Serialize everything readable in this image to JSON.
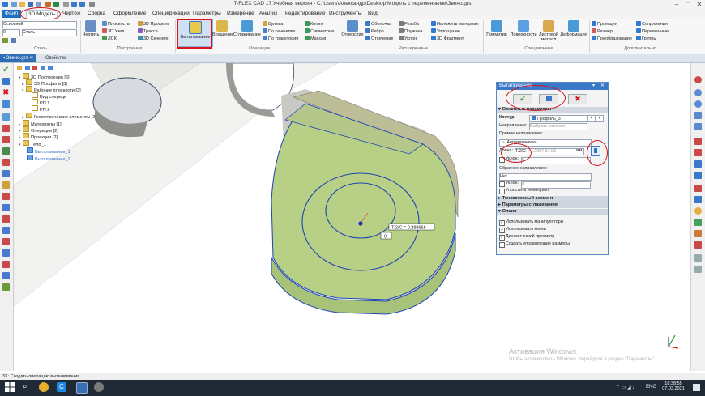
{
  "app": {
    "title": "T-FLEX CAD 17 Учебная версия - C:\\Users\\Александр\\Desktop\\Модель с переменными\\Звено.grs"
  },
  "menu": [
    "Файл",
    "3D Модель",
    "Чертёж",
    "Сборка",
    "Оформление",
    "Спецификации",
    "Параметры",
    "Измерение",
    "Анализ",
    "Редактирование",
    "Инструменты",
    "Вид"
  ],
  "ribbon": {
    "style": {
      "layer": "Основной",
      "value": "0",
      "line_style": "Сталь",
      "group": "Стиль"
    },
    "construct": {
      "draw": "Чертить",
      "items": [
        "Плоскость",
        "3D Узел",
        "ЛСК",
        "3D Профиль",
        "Трасса",
        "3D Сечение"
      ],
      "group": "Построения"
    },
    "operations": {
      "extrude": "Выталкивание",
      "rotate": "Вращение",
      "smooth": "Сглаживание",
      "items": [
        "Булева",
        "По сечениям",
        "По траектории",
        "Копия",
        "Симметрия",
        "Массив"
      ],
      "group": "Операции"
    },
    "extended": {
      "hole": "Отверстие",
      "items": [
        "Оболочка",
        "Ребро",
        "Отсечение",
        "Резьба",
        "Пружина",
        "Уклон",
        "Наложить материал",
        "Упрощение",
        "3D Фрагмент"
      ],
      "group": "Расширенные"
    },
    "special": {
      "primitives": "Примитив",
      "surfaces": "Поверхности",
      "sheet": "Листовой металл",
      "deform": "Деформация",
      "group": "Специальные"
    },
    "extra": {
      "items": [
        "Проекция",
        "Размер",
        "Преобразование",
        "Сопряжения",
        "Переменные",
        "Группы"
      ],
      "group": "Дополнительно"
    }
  },
  "tabs": {
    "doc": "Звено.grs",
    "props": "Свойства"
  },
  "tree": [
    "3D Построения [6]",
    "3D Профили [3]",
    "Рабочие плоскости [3]",
    "Вид спереди",
    "РП 1",
    "РП 2",
    "Геометрические элементы [2]",
    "Материалы [1]",
    "Операции [2]",
    "Проекции [2]",
    "Тело_1",
    "Выталкивание_1",
    "Выталкивание_2"
  ],
  "dialog": {
    "title": "Выталкивание",
    "sections": {
      "main": "Основные параметры",
      "thin": "Тонкостенный элемент",
      "smooth": "Параметры сглаживания",
      "options": "Опции"
    },
    "contour_label": "Контур:",
    "contour_value": "Профиль_3",
    "direction_label": "Направление:",
    "direction_placeholder": "Выбрать элемент",
    "forward_label": "Прямое направление:",
    "auto_value": "Автоматически",
    "length_label": "Длина:",
    "length_value": "T/2/С",
    "length_result": "= 1.2987 37.93",
    "length_unit": "мм",
    "slope_label": "Уклон:",
    "slope_value": "0",
    "backward_label": "Обратное направление:",
    "backward_value": "Нет",
    "slope2_label": "Уклон:",
    "slope2_value": "0",
    "simplify": "Упростить геометрию",
    "options": [
      {
        "label": "Использовать манипуляторы",
        "checked": true
      },
      {
        "label": "Использовать метки",
        "checked": true
      },
      {
        "label": "Динамический просмотр",
        "checked": true
      },
      {
        "label": "Создать управляющие размеры",
        "checked": false
      }
    ],
    "ok_icon": "check-icon",
    "preview_icon": "preview-icon",
    "cancel_icon": "close-icon"
  },
  "viewport": {
    "dim_label": "T/2/С = 0.298666",
    "dim_small": "0"
  },
  "watermark": {
    "line1": "Активация Windows",
    "line2": "Чтобы активировать Windows, перейдите в раздел \"Параметры\"."
  },
  "status": "3Х: Создать операцию выталкивания",
  "taskbar": {
    "lang": "ENG",
    "time": "18:38:55",
    "date": "07.03.2021"
  },
  "colors": {
    "accent": "#3a79c9",
    "annotation": "#d8141c",
    "face": "#b8cf86",
    "edge": "#1e46b4"
  }
}
